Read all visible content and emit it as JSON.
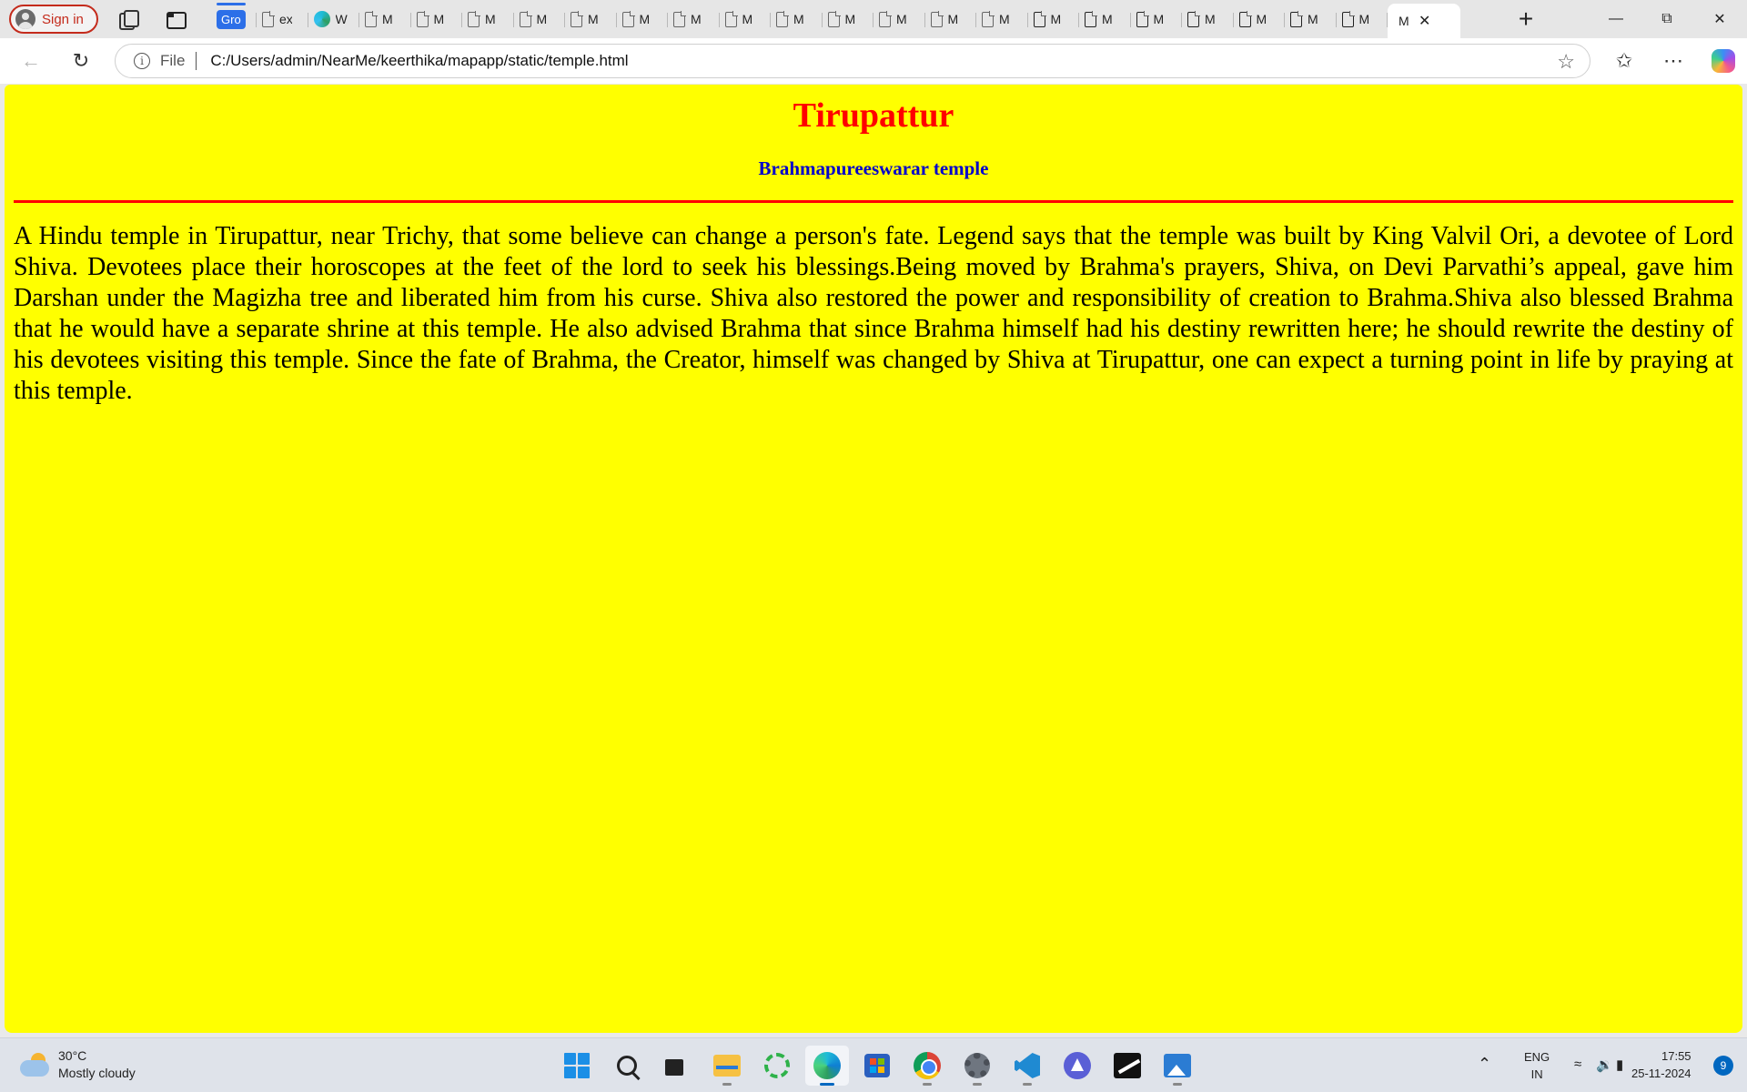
{
  "browser": {
    "signin_label": "Sign in",
    "tab_group_label": "Gro",
    "tabs": [
      {
        "label": "ex",
        "icon": "page-icon"
      },
      {
        "label": "W",
        "icon": "edge-icon"
      },
      {
        "label": "M",
        "icon": "page-icon"
      },
      {
        "label": "M",
        "icon": "page-icon"
      },
      {
        "label": "M",
        "icon": "page-icon"
      },
      {
        "label": "M",
        "icon": "page-icon"
      },
      {
        "label": "M",
        "icon": "page-icon"
      },
      {
        "label": "M",
        "icon": "page-icon"
      },
      {
        "label": "M",
        "icon": "page-icon"
      },
      {
        "label": "M",
        "icon": "page-icon"
      },
      {
        "label": "M",
        "icon": "page-icon"
      },
      {
        "label": "M",
        "icon": "page-icon"
      },
      {
        "label": "M",
        "icon": "page-icon"
      },
      {
        "label": "M",
        "icon": "page-icon"
      },
      {
        "label": "M",
        "icon": "page-icon"
      },
      {
        "label": "M",
        "icon": "page-icon"
      },
      {
        "label": "M",
        "icon": "page-icon"
      },
      {
        "label": "M",
        "icon": "page-icon"
      },
      {
        "label": "M",
        "icon": "page-icon"
      },
      {
        "label": "M",
        "icon": "page-icon"
      },
      {
        "label": "M",
        "icon": "page-icon"
      },
      {
        "label": "M",
        "icon": "page-icon"
      }
    ],
    "active_tab_label": "M",
    "address": {
      "scheme_label": "File",
      "url": "C:/Users/admin/NearMe/keerthika/mapapp/static/temple.html"
    }
  },
  "page": {
    "title": "Tirupattur",
    "subtitle": "Brahmapureeswarar temple",
    "body": "A Hindu temple in Tirupattur, near Trichy, that some believe can change a person's fate. Legend says that the temple was built by King Valvil Ori, a devotee of Lord Shiva. Devotees place their horoscopes at the feet of the lord to seek his blessings.Being moved by Brahma's prayers, Shiva, on Devi Parvathi’s appeal, gave him Darshan under the Magizha tree and liberated him from his curse. Shiva also restored the power and responsibility of creation to Brahma.Shiva also blessed Brahma that he would have a separate shrine at this temple. He also advised Brahma that since Brahma himself had his destiny rewritten here; he should rewrite the destiny of his devotees visiting this temple. Since the fate of Brahma, the Creator, himself was changed by Shiva at Tirupattur, one can expect a turning point in life by praying at this temple.",
    "colors": {
      "background": "#ffff00",
      "title": "#ff0000",
      "subtitle": "#0000cd",
      "rule": "#ff0000"
    }
  },
  "taskbar": {
    "weather": {
      "temp": "30°C",
      "condition": "Mostly cloudy"
    },
    "apps": [
      "start",
      "search",
      "task-view",
      "file-explorer",
      "app-loader",
      "edge",
      "store",
      "chrome",
      "settings",
      "vscode",
      "arc",
      "capcut",
      "photos"
    ],
    "language": {
      "line1": "ENG",
      "line2": "IN"
    },
    "clock": {
      "time": "17:55",
      "date": "25-11-2024"
    },
    "notification_count": "9"
  }
}
